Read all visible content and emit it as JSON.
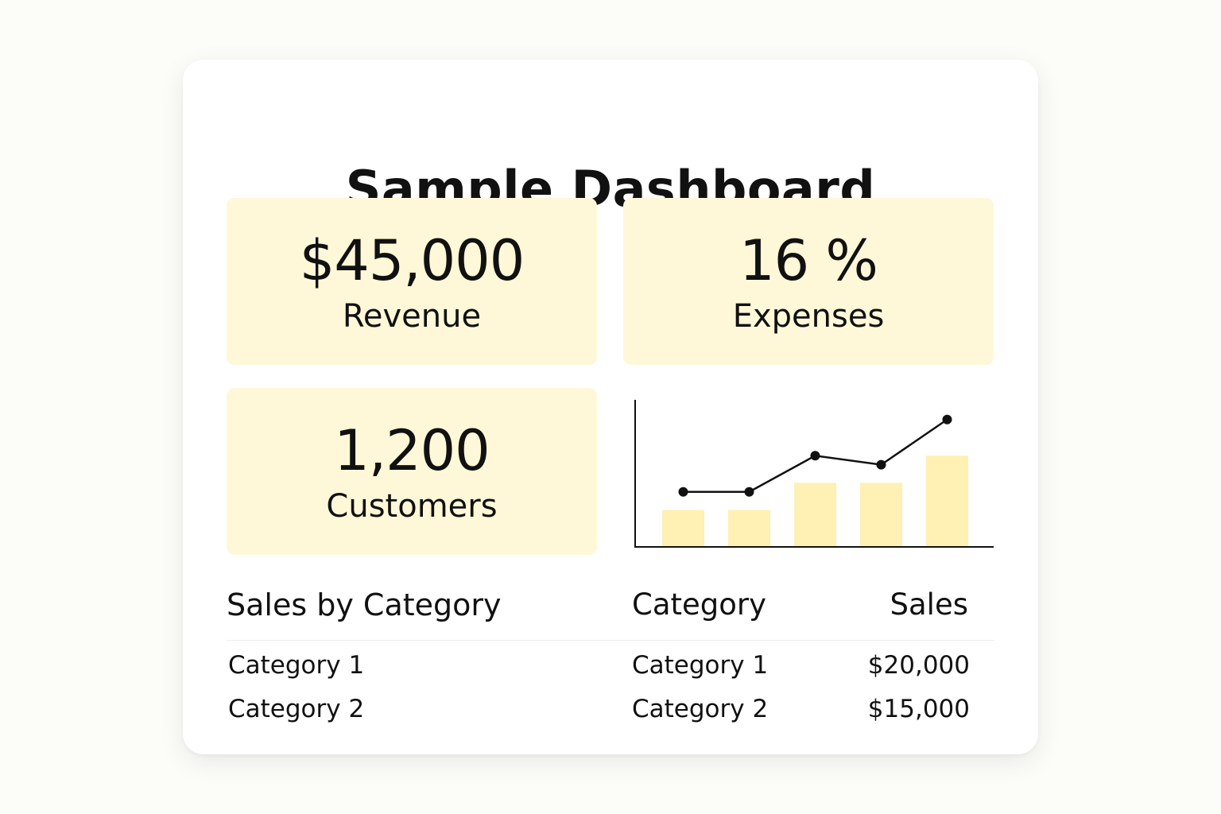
{
  "title": "Sample Dashboard",
  "kpis": [
    {
      "value": "$45,000",
      "label": "Revenue"
    },
    {
      "value": "16 %",
      "label": "Expenses"
    },
    {
      "value": "1,200",
      "label": "Customers"
    }
  ],
  "colors": {
    "card_fill": "#fff8d8",
    "bar_fill": "#fff0b3",
    "line": "#111111"
  },
  "chart_data": {
    "type": "bar",
    "categories": [
      "",
      "",
      "",
      "",
      ""
    ],
    "series": [
      {
        "type": "bar",
        "values": [
          2,
          2,
          3.5,
          3.5,
          5
        ]
      },
      {
        "type": "line",
        "values": [
          3,
          3,
          5,
          4.5,
          7
        ]
      }
    ],
    "ylim": [
      0,
      8
    ],
    "grid": false
  },
  "sales_section": {
    "title": "Sales by Category",
    "left_items": [
      "Category 1",
      "Category 2"
    ]
  },
  "sales_table": {
    "headers": [
      "Category",
      "Sales"
    ],
    "rows": [
      [
        "Category 1",
        "$20,000"
      ],
      [
        "Category 2",
        "$15,000"
      ]
    ]
  }
}
